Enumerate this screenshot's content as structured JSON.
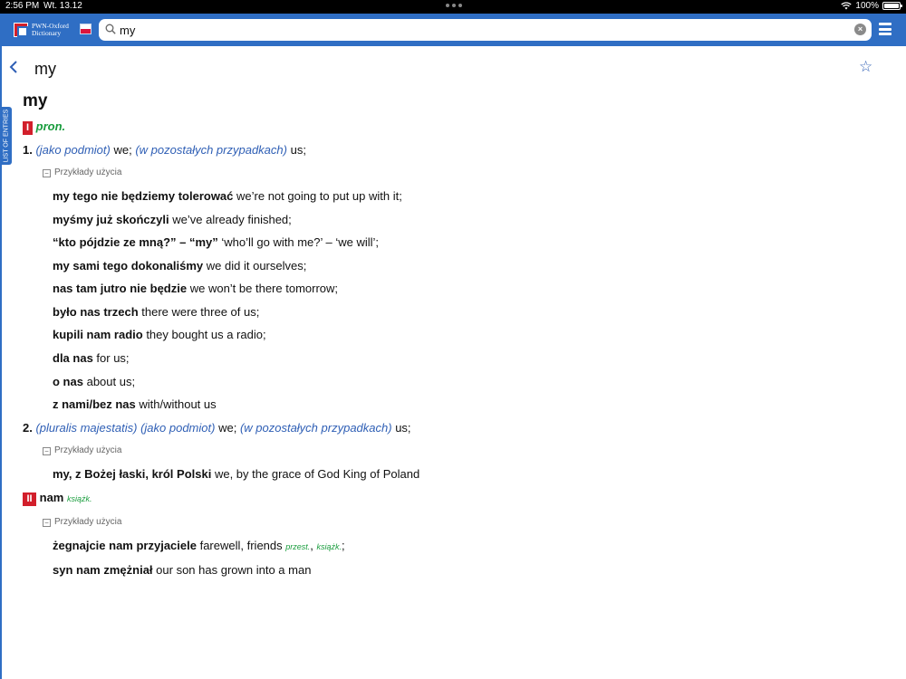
{
  "status": {
    "time": "2:56 PM",
    "date": "Wt. 13.12",
    "battery": "100%",
    "battery_level": 1.0
  },
  "header": {
    "logo_line1": "PWN-Oxford",
    "logo_line2": "Dictionary",
    "search": {
      "value": "my",
      "placeholder": ""
    }
  },
  "side_tab": {
    "label": "LIST OF ENTRIES"
  },
  "nav": {
    "title": "my"
  },
  "entry": {
    "headword": "my",
    "part1": {
      "roman": "I",
      "pos": "pron.",
      "sense1": {
        "num": "1.",
        "q1": "(jako podmiot)",
        "t1": "we;",
        "q2": "(w pozostałych przypadkach)",
        "t2": "us;",
        "examples_label": "Przykłady użycia",
        "examples": [
          {
            "pl": "my tego nie będziemy tolerować",
            "en": "we’re not going to put up with it;"
          },
          {
            "pl": "myśmy już skończyli",
            "en": "we’ve already finished;"
          },
          {
            "pl": "“kto pójdzie ze mną?” – “my”",
            "en": "‘who’ll go with me?’ – ‘we will’;"
          },
          {
            "pl": "my sami tego dokonaliśmy",
            "en": "we did it ourselves;"
          },
          {
            "pl": "nas tam jutro nie będzie",
            "en": "we won’t be there tomorrow;"
          },
          {
            "pl": "było nas trzech",
            "en": "there were three of us;"
          },
          {
            "pl": "kupili nam radio",
            "en": "they bought us a radio;"
          },
          {
            "pl": "dla nas",
            "en": "for us;"
          },
          {
            "pl": "o nas",
            "en": "about us;"
          },
          {
            "pl": "z nami/bez nas",
            "en": "with/without us"
          }
        ]
      },
      "sense2": {
        "num": "2.",
        "q1": "(pluralis majestatis)",
        "q2": "(jako podmiot)",
        "t1": "we;",
        "q3": "(w pozostałych przypadkach)",
        "t2": "us;",
        "examples_label": "Przykłady użycia",
        "examples": [
          {
            "pl": "my, z Bożej łaski, król Polski",
            "en": "we, by the grace of God King of Poland"
          }
        ]
      }
    },
    "part2": {
      "roman": "II",
      "word": "nam",
      "register": "książk.",
      "examples_label": "Przykłady użycia",
      "ex1": {
        "pl": "żegnajcie nam przyjaciele",
        "en": "farewell, friends",
        "reg1": "przest.",
        "sep": ",",
        "reg2": "książk.",
        "end": ";"
      },
      "ex2": {
        "pl": "syn nam zmężniał",
        "en": "our son has grown into a man"
      }
    }
  }
}
